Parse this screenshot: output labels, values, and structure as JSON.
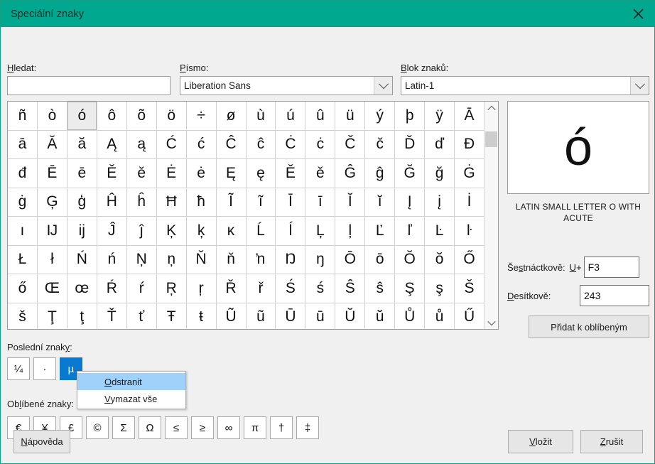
{
  "window": {
    "title": "Speciální znaky",
    "close_icon": "close-icon",
    "titlebar_color": "#00a88f"
  },
  "search": {
    "label": "Hledat:",
    "label_accel": "H",
    "value": "",
    "placeholder": ""
  },
  "font": {
    "label": "Písmo:",
    "label_accel": "P",
    "value": "Liberation Sans",
    "arrow_icon": "chevron-down-icon"
  },
  "block": {
    "label": "Blok znaků:",
    "label_accel": "B",
    "value": "Latin-1",
    "arrow_icon": "chevron-down-icon"
  },
  "grid": {
    "selected_index": 2,
    "scroll_up_icon": "chevron-up-icon",
    "scroll_down_icon": "chevron-down-icon",
    "characters": [
      "ñ",
      "ò",
      "ó",
      "ô",
      "õ",
      "ö",
      "÷",
      "ø",
      "ù",
      "ú",
      "û",
      "ü",
      "ý",
      "þ",
      "ÿ",
      "Ā",
      "ā",
      "Ă",
      "ă",
      "Ą",
      "ą",
      "Ć",
      "ć",
      "Ĉ",
      "ĉ",
      "Ċ",
      "ċ",
      "Č",
      "č",
      "Ď",
      "ď",
      "Đ",
      "đ",
      "Ē",
      "ē",
      "Ě",
      "ě",
      "Ė",
      "ė",
      "Ę",
      "ę",
      "Ě",
      "ě",
      "Ĝ",
      "ĝ",
      "Ğ",
      "ğ",
      "Ġ",
      "ġ",
      "Ģ",
      "ģ",
      "Ĥ",
      "ĥ",
      "Ħ",
      "ħ",
      "Ĩ",
      "ĩ",
      "Ī",
      "ī",
      "Ĭ",
      "ĭ",
      "Į",
      "į",
      "İ",
      "ı",
      "Ĳ",
      "ĳ",
      "Ĵ",
      "ĵ",
      "Ķ",
      "ķ",
      "ĸ",
      "Ĺ",
      "ĺ",
      "Ļ",
      "ļ",
      "Ľ",
      "ľ",
      "Ŀ",
      "ŀ",
      "Ł",
      "ł",
      "Ń",
      "ń",
      "Ņ",
      "ņ",
      "Ň",
      "ň",
      "ŉ",
      "Ŋ",
      "ŋ",
      "Ō",
      "ō",
      "Ŏ",
      "ŏ",
      "Ő",
      "ő",
      "Œ",
      "œ",
      "Ŕ",
      "ŕ",
      "Ŗ",
      "ŗ",
      "Ř",
      "ř",
      "Ś",
      "ś",
      "Ŝ",
      "ŝ",
      "Ş",
      "ş",
      "Š",
      "š",
      "Ţ",
      "ţ",
      "Ť",
      "ť",
      "Ŧ",
      "ŧ",
      "Ũ",
      "ũ",
      "Ū",
      "ū",
      "Ŭ",
      "ŭ",
      "Ů",
      "ů",
      "Ű"
    ]
  },
  "preview": {
    "glyph": "ó",
    "name": "LATIN SMALL LETTER O WITH ACUTE"
  },
  "hex": {
    "label": "Šestnáctkově:",
    "label_accel": "s",
    "prefix": "U+",
    "prefix_accel": "U",
    "value": "F3"
  },
  "dec": {
    "label": "Desítkově:",
    "label_accel": "D",
    "value": "243"
  },
  "favorites_button": {
    "label": "Přidat k oblíbeným"
  },
  "recent": {
    "label": "Poslední znaky:",
    "label_accel": "y",
    "selected_index": 2,
    "chars": [
      "¼",
      "·",
      "µ"
    ]
  },
  "favorites": {
    "label": "Oblíbené znaky:",
    "label_accel": "l",
    "chars": [
      "€",
      "¥",
      "£",
      "©",
      "Σ",
      "Ω",
      "≤",
      "≥",
      "∞",
      "π",
      "†",
      "‡"
    ]
  },
  "context_menu": {
    "items": [
      {
        "label": "Odstranit",
        "accel": "O",
        "highlighted": true
      },
      {
        "label": "Vymazat vše",
        "accel": "V",
        "highlighted": false
      }
    ]
  },
  "footer": {
    "help": {
      "label": "Nápověda",
      "accel": "N"
    },
    "insert": {
      "label": "Vložit",
      "accel": "V"
    },
    "cancel": {
      "label": "Zrušit",
      "accel": "Z"
    }
  }
}
